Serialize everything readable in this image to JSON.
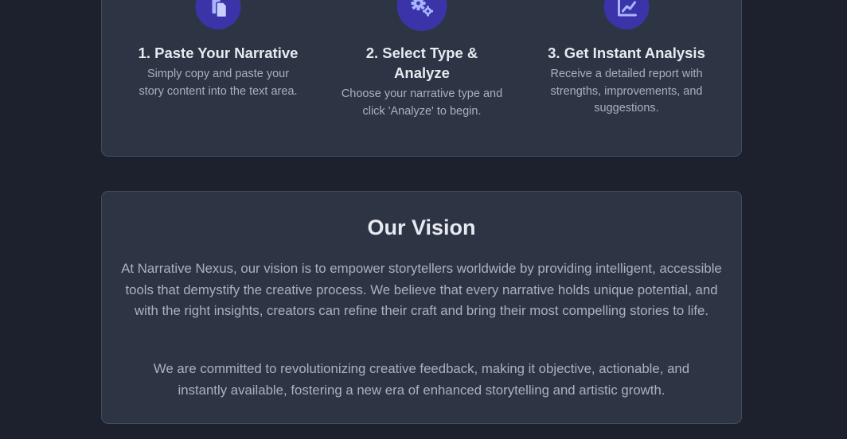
{
  "steps": [
    {
      "icon": "paste-icon",
      "title": "1. Paste Your Narrative",
      "description": "Simply copy and paste your story content into the text area."
    },
    {
      "icon": "gears-icon",
      "title": "2. Select Type & Analyze",
      "description": "Choose your narrative type and click 'Analyze' to begin."
    },
    {
      "icon": "chart-line-icon",
      "title": "3. Get Instant Analysis",
      "description": "Receive a detailed report with strengths, improvements, and suggestions."
    }
  ],
  "vision": {
    "title": "Our Vision",
    "paragraph1": "At Narrative Nexus, our vision is to empower storytellers worldwide by providing intelligent, accessible tools that demystify the creative process. We believe that every narrative holds unique potential, and with the right insights, creators can refine their craft and bring their most compelling stories to life.",
    "paragraph2": "We are committed to revolutionizing creative feedback, making it objective, actionable, and instantly available, fostering a new era of enhanced storytelling and artistic growth."
  },
  "colors": {
    "page_background": "#1c212d",
    "card_background": "#2d3444",
    "icon_circle": "#3b33a8",
    "icon_glyph": "#a8b4ff",
    "heading_text": "#e7eaf0",
    "body_text": "#a9b0bd"
  }
}
